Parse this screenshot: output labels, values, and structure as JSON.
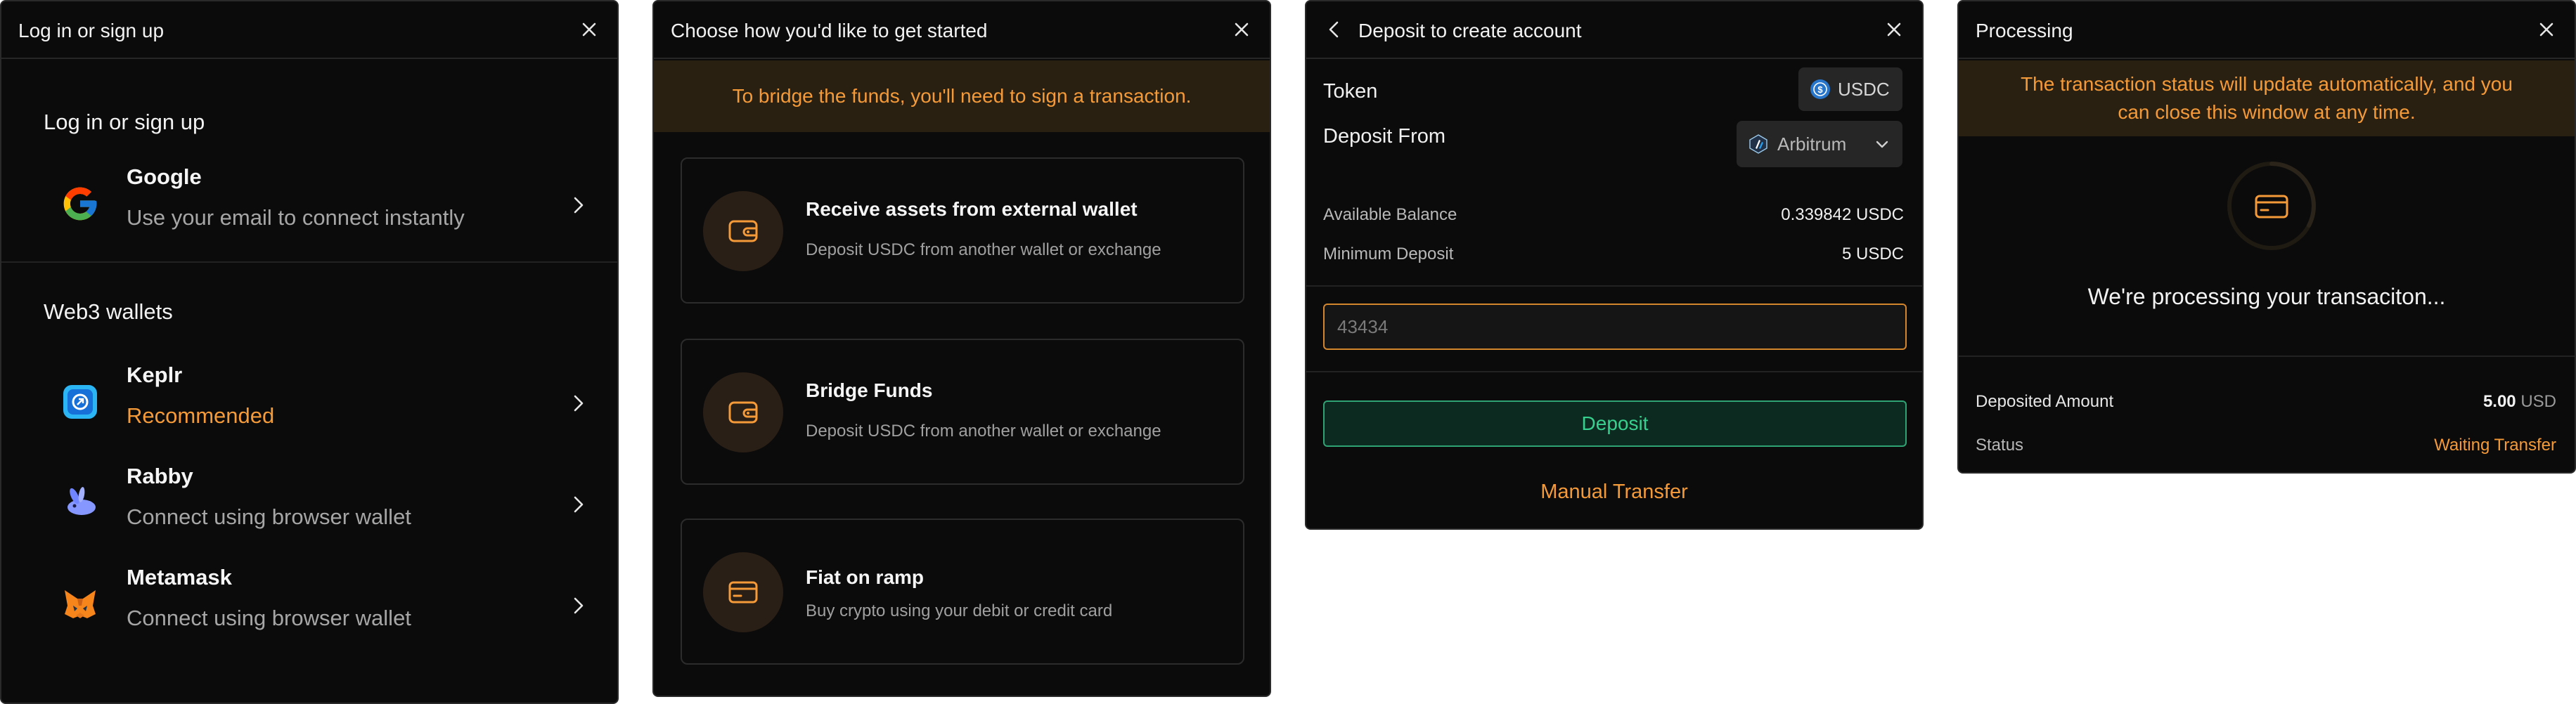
{
  "colors": {
    "accent": "#f59a38",
    "success": "#38d08f",
    "panel_bg": "#0b0b0b",
    "border": "#2a2a2a"
  },
  "login": {
    "header_title": "Log in or sign up",
    "section_title": "Log in or sign up",
    "google": {
      "name": "Google",
      "sub": "Use your email to connect instantly",
      "icon": "google-icon"
    },
    "web3_title": "Web3 wallets",
    "wallets": [
      {
        "name": "Keplr",
        "sub": "Recommended",
        "icon": "keplr-icon"
      },
      {
        "name": "Rabby",
        "sub": "Connect using browser wallet",
        "icon": "rabby-icon"
      },
      {
        "name": "Metamask",
        "sub": "Connect using browser wallet",
        "icon": "metamask-icon"
      }
    ]
  },
  "start": {
    "header_title": "Choose how you'd like to get started",
    "banner": "To bridge the funds, you'll need to sign a transaction.",
    "options": [
      {
        "title": "Receive assets from external wallet",
        "sub": "Deposit USDC from another wallet or exchange",
        "icon": "wallet-icon"
      },
      {
        "title": "Bridge Funds",
        "sub": "Deposit USDC from another wallet or exchange",
        "icon": "wallet-icon"
      },
      {
        "title": "Fiat on ramp",
        "sub": "Buy crypto using your debit or credit card",
        "icon": "card-icon"
      }
    ]
  },
  "deposit": {
    "header_title": "Deposit to create account",
    "token_label": "Token",
    "token_value": "USDC",
    "from_label": "Deposit From",
    "from_value": "Arbitrum",
    "balance_label": "Available Balance",
    "balance_value": "0.339842 USDC",
    "min_label": "Minimum Deposit",
    "min_value": "5 USDC",
    "amount_placeholder": "43434",
    "deposit_button": "Deposit",
    "manual_transfer": "Manual Transfer"
  },
  "processing": {
    "header_title": "Processing",
    "banner_line1": "The transaction status will update automatically, and you",
    "banner_line2": "can close this window at any time.",
    "message": "We're processing your transaciton...",
    "deposited_label": "Deposited Amount",
    "deposited_value": "5.00",
    "deposited_unit": "USD",
    "status_label": "Status",
    "status_value": "Waiting Transfer"
  }
}
